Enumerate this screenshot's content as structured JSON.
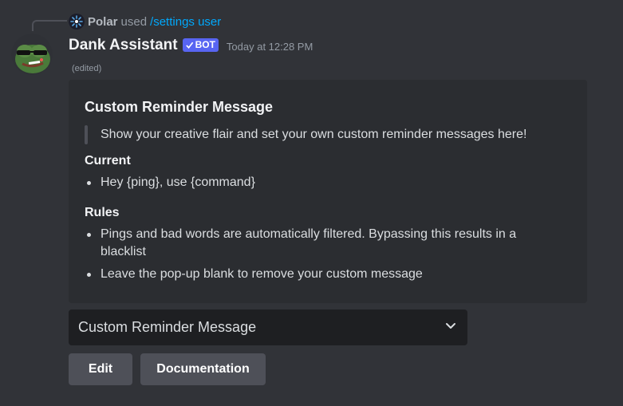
{
  "command": {
    "user": "Polar",
    "used_text": "used",
    "command_name": "/settings user"
  },
  "message": {
    "author": "Dank Assistant",
    "bot_tag": "BOT",
    "timestamp": "Today at 12:28 PM",
    "edited": "(edited)"
  },
  "embed": {
    "title": "Custom Reminder Message",
    "quote": "Show your creative flair and set your own custom reminder messages here!",
    "fields": [
      {
        "name": "Current",
        "items": [
          "Hey {ping}, use {command}"
        ]
      },
      {
        "name": "Rules",
        "items": [
          "Pings and bad words are automatically filtered. Bypassing this results in a blacklist",
          "Leave the pop-up blank to remove your custom message"
        ]
      }
    ]
  },
  "select_menu": {
    "selected": "Custom Reminder Message",
    "icon": "chevron-down-icon"
  },
  "buttons": {
    "edit_label": "Edit",
    "docs_label": "Documentation"
  },
  "colors": {
    "background": "#313338",
    "embed_background": "#2b2d31",
    "bot_tag": "#5865f2",
    "command_link": "#00a8fc",
    "button": "#4e5058",
    "select_background": "#1e1f22"
  }
}
